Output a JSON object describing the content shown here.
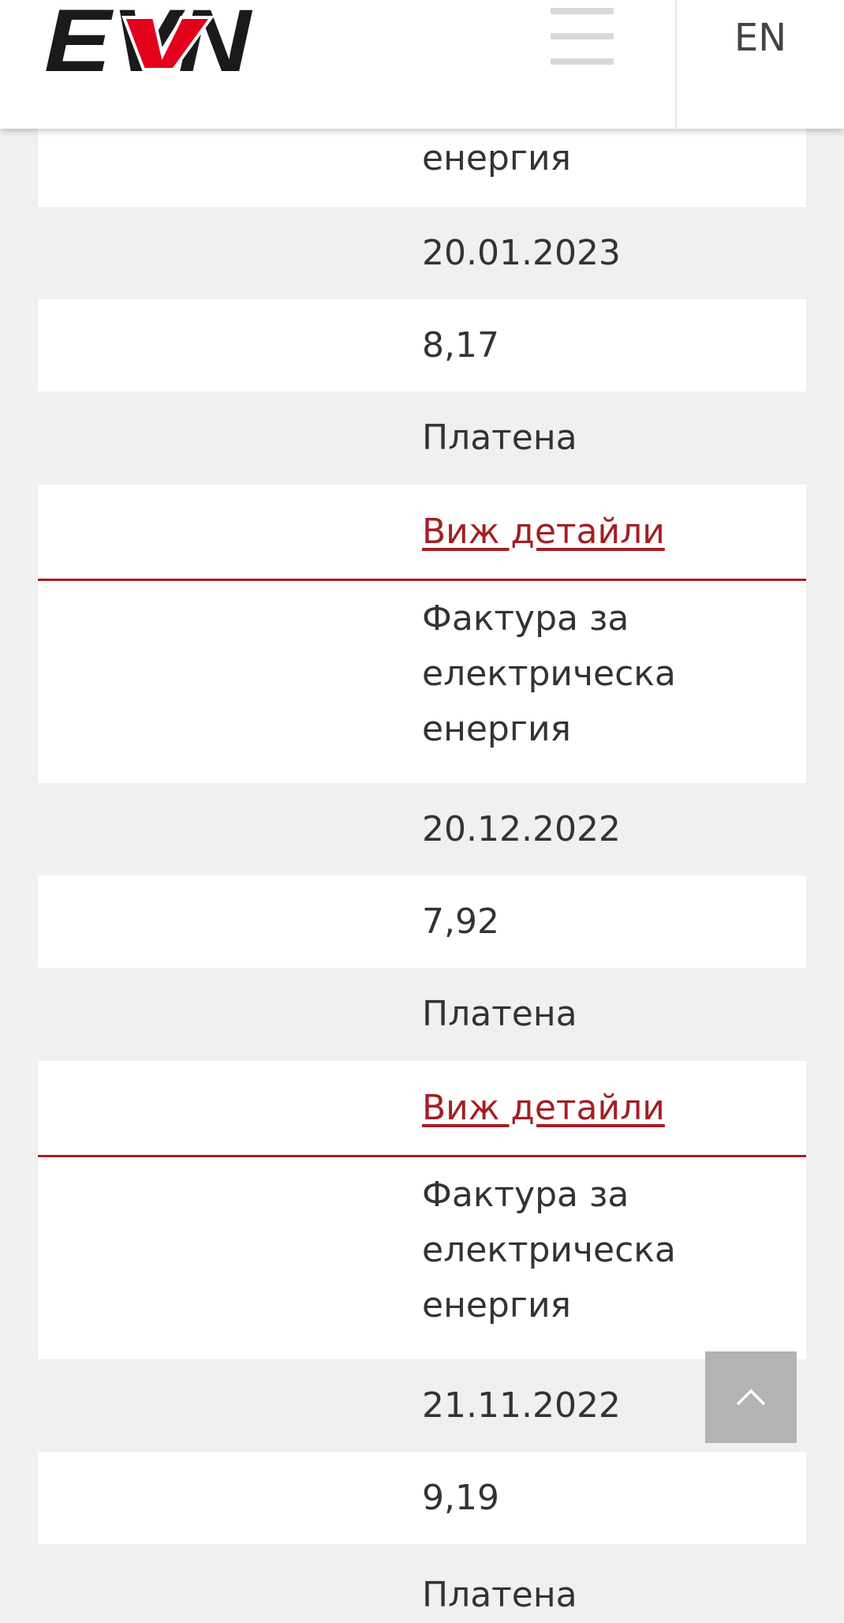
{
  "header": {
    "logo_text": "EVN",
    "language_label": "EN",
    "brand_colors": {
      "dark": "#1a1a1a",
      "accent": "#e3001b"
    }
  },
  "invoices": [
    {
      "type_label": "енергия",
      "date": "20.01.2023",
      "amount": "8,17",
      "status": "Платена",
      "details_link": "Виж детайли"
    },
    {
      "type_label_lines": [
        "Фактура за",
        "електрическа",
        "енергия"
      ],
      "date": "20.12.2022",
      "amount": "7,92",
      "status": "Платена",
      "details_link": "Виж детайли"
    },
    {
      "type_label_lines": [
        "Фактура за",
        "електрическа",
        "енергия"
      ],
      "date": "21.11.2022",
      "amount": "9,19",
      "status": "Платена"
    }
  ],
  "colors": {
    "link": "#a31f24",
    "background": "#f0f0f0",
    "row_alt": "#ffffff"
  },
  "icons": {
    "menu": "hamburger-icon",
    "scroll_top": "chevron-up-icon"
  }
}
